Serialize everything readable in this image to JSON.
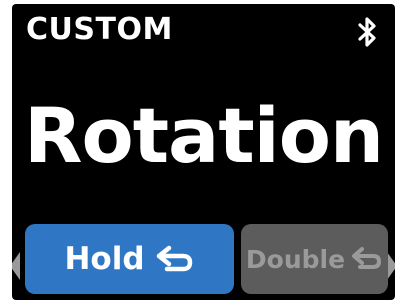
{
  "header": {
    "mode_label": "CUSTOM",
    "status_icon": "bluetooth-icon"
  },
  "main": {
    "title": "Rotation"
  },
  "actions": {
    "hold": {
      "label": "Hold",
      "icon": "return-arrow-icon",
      "selected": true,
      "color": "#2f77c4"
    },
    "double": {
      "label": "Double",
      "icon": "return-arrow-icon",
      "selected": false,
      "color": "#5c5c5c"
    }
  },
  "colors": {
    "background": "#000000",
    "text": "#ffffff",
    "accent": "#2f77c4",
    "inactive": "#5c5c5c",
    "inactive_text": "#9a9a9a"
  }
}
